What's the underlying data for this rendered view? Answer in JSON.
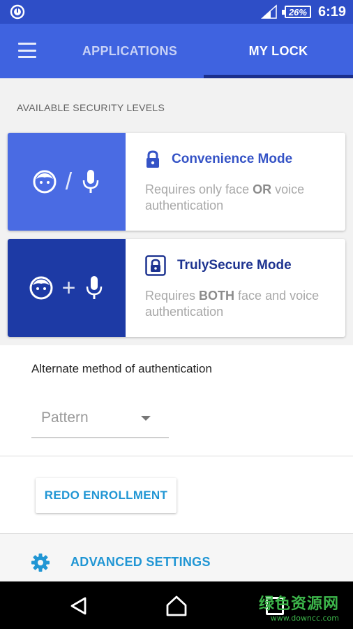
{
  "status_bar": {
    "battery": "26%",
    "time": "6:19",
    "icons": [
      "app-notification-icon",
      "signal-icon",
      "battery-icon"
    ]
  },
  "app_bar": {
    "menu_icon": "hamburger-menu-icon",
    "tabs": [
      {
        "label": "APPLICATIONS",
        "selected": false
      },
      {
        "label": "MY LOCK",
        "selected": true
      }
    ]
  },
  "security": {
    "header": "AVAILABLE SECURITY LEVELS",
    "modes": [
      {
        "title": "Convenience Mode",
        "desc_before": "Requires only face ",
        "desc_emphasis": "OR",
        "desc_after": " voice authentication",
        "operator": "/",
        "icon": "lock-icon"
      },
      {
        "title": "TrulySecure Mode",
        "desc_before": "Requires ",
        "desc_emphasis": "BOTH",
        "desc_after": " face and voice authentication",
        "operator": "+",
        "icon": "boxed-lock-icon"
      }
    ]
  },
  "alternate": {
    "label": "Alternate method of authentication",
    "selected": "Pattern"
  },
  "redo_button": "REDO ENROLLMENT",
  "advanced_settings": "ADVANCED SETTINGS",
  "watermark": {
    "cn": "绿色资源网",
    "url": "www.downcc.com"
  },
  "colors": {
    "status_bar": "#2e4ec7",
    "app_bar": "#3f63e0",
    "convenience": "#4a6be3",
    "secure": "#1d3aa5",
    "accent": "#2196d4"
  }
}
